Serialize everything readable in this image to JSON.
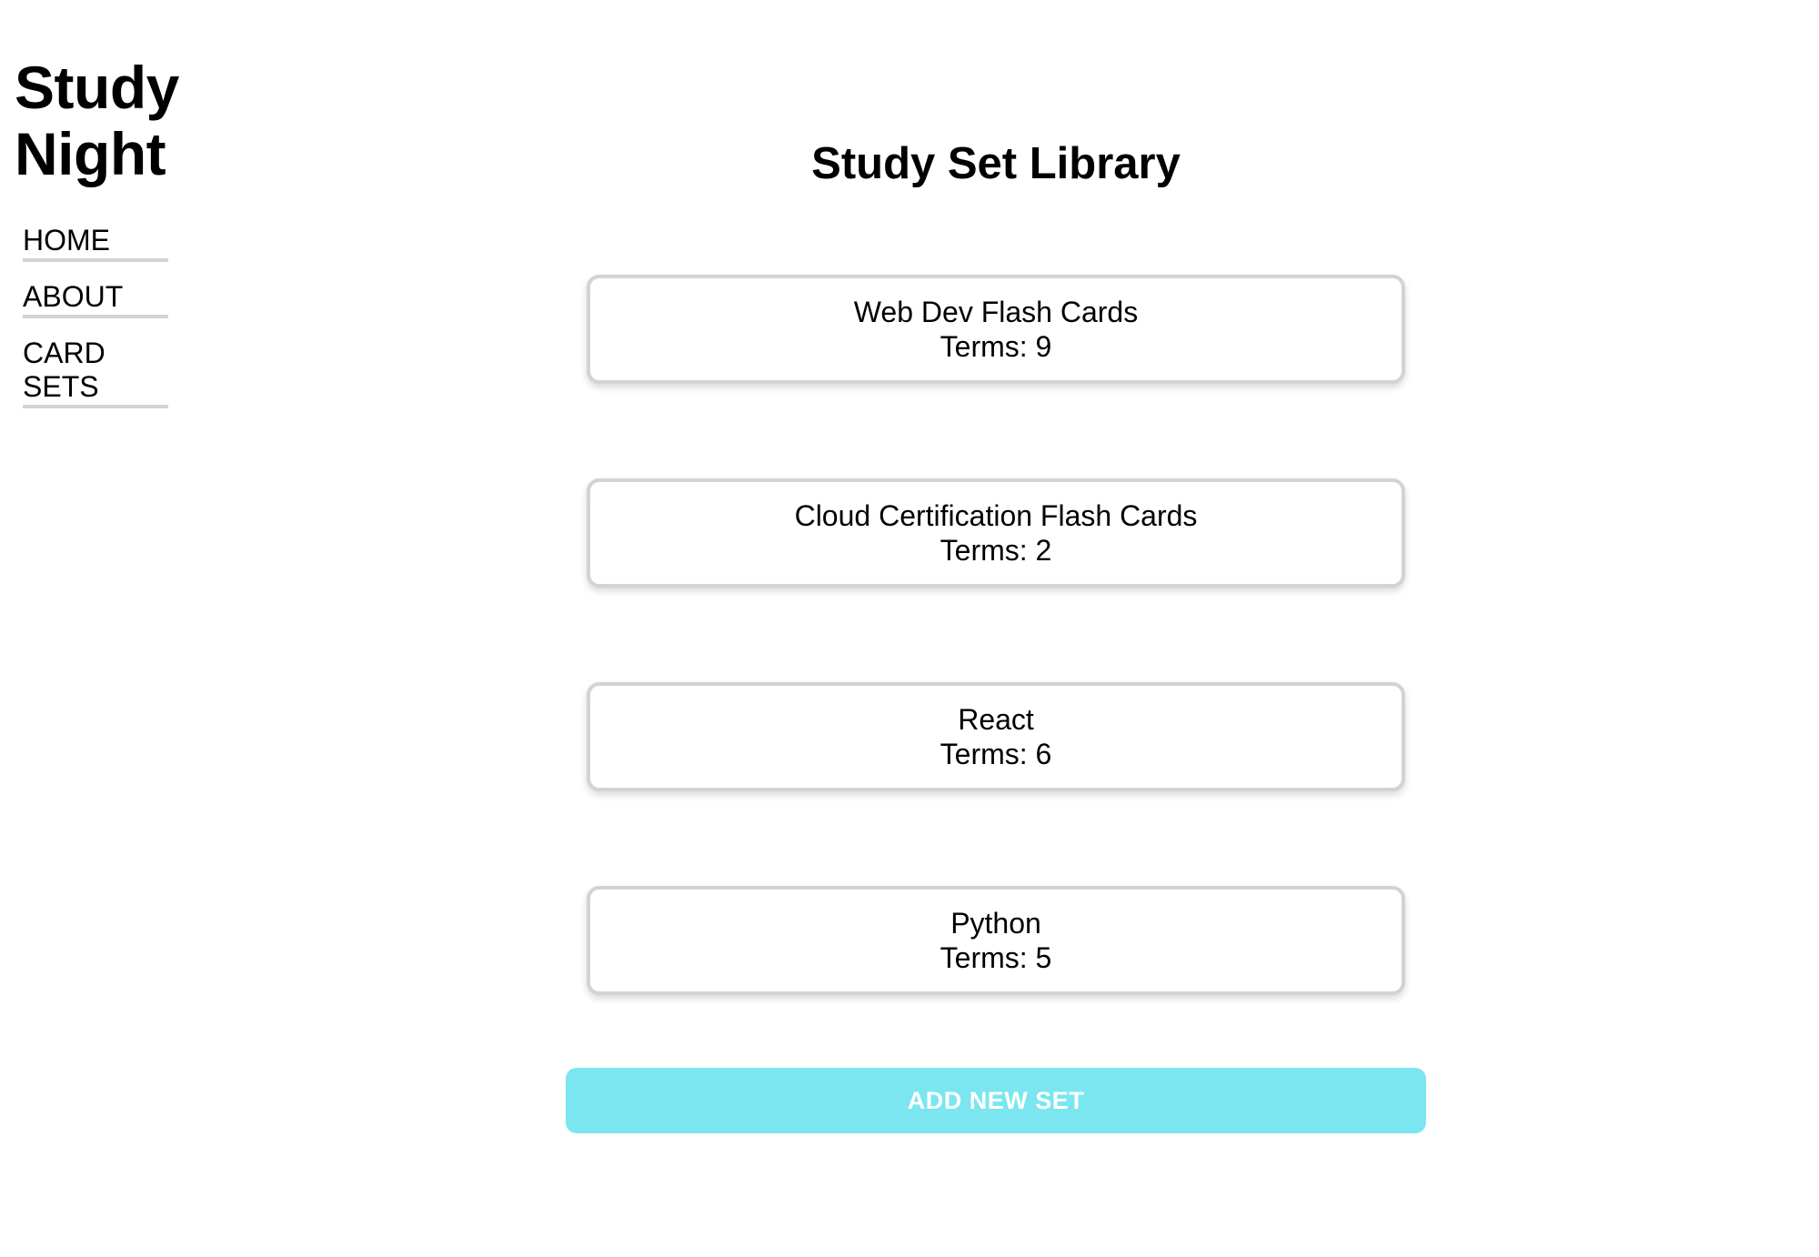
{
  "app": {
    "brand_line1": "Study",
    "brand_line2": "Night"
  },
  "nav": {
    "items": [
      {
        "label": "HOME"
      },
      {
        "label": "ABOUT"
      },
      {
        "label": "CARD SETS"
      }
    ]
  },
  "main": {
    "title": "Study Set Library",
    "sets": [
      {
        "name": "Web Dev Flash Cards",
        "terms": "Terms: 9"
      },
      {
        "name": "Cloud Certification Flash Cards",
        "terms": "Terms: 2"
      },
      {
        "name": "React",
        "terms": "Terms: 6"
      },
      {
        "name": "Python",
        "terms": "Terms: 5"
      }
    ],
    "add_button_label": "ADD NEW SET"
  },
  "colors": {
    "accent": "#7be6ef",
    "card_border": "#d3d3d3",
    "nav_underline": "#d3d3d3"
  }
}
